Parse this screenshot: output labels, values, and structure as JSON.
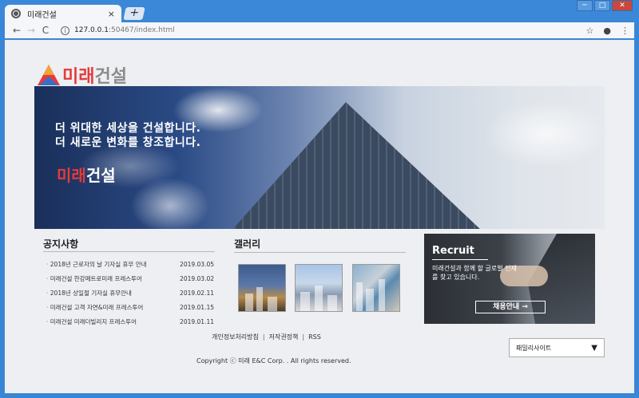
{
  "browser": {
    "tab_title": "미래건설",
    "tab_close": "×",
    "new_tab": "+",
    "url_host": "127.0.0.1",
    "url_path": ":50467/index.html",
    "window_minimize": "─",
    "window_maximize": "□",
    "window_close": "✕",
    "back": "←",
    "forward": "→",
    "reload": "C",
    "star": "☆",
    "account": "●",
    "menu": "⋮"
  },
  "logo": {
    "highlight": "미래",
    "rest": "건설"
  },
  "hero": {
    "line1": "더 위대한 세상을 건설합니다.",
    "line2": "더 새로운 변화를 창조합니다.",
    "brand_highlight": "미래",
    "brand_rest": "건설"
  },
  "notice": {
    "title": "공지사항",
    "items": [
      {
        "title": "2018년 근로자의 날 기자실 휴무 안내",
        "date": "2019.03.05"
      },
      {
        "title": "미래건설 한강메트로미래 프레스투어",
        "date": "2019.03.02"
      },
      {
        "title": "2018년 상일절 기자실 휴무안내",
        "date": "2019.02.11"
      },
      {
        "title": "미래건설 고객 자연&미래 프레스투어",
        "date": "2019.01.15"
      },
      {
        "title": "미래건설 미래더빌리지 프레스투어",
        "date": "2019.01.11"
      }
    ]
  },
  "gallery": {
    "title": "갤러리"
  },
  "recruit": {
    "title": "Recruit",
    "desc": "미래건설과 함께 할 글로벌 인재를 찾고 있습니다.",
    "button": "채용안내 →"
  },
  "footer": {
    "links": [
      "개인정보처리방침",
      "저작권정책",
      "RSS"
    ],
    "separator": "|",
    "copyright": "Copyright ⓒ 미래 E&C Corp. . All rights reserved.",
    "family_site": "패밀리사이트",
    "family_arrow": "▼"
  },
  "colors": {
    "brand_red": "#e63a3a",
    "brand_gray": "#8b8b8b"
  }
}
